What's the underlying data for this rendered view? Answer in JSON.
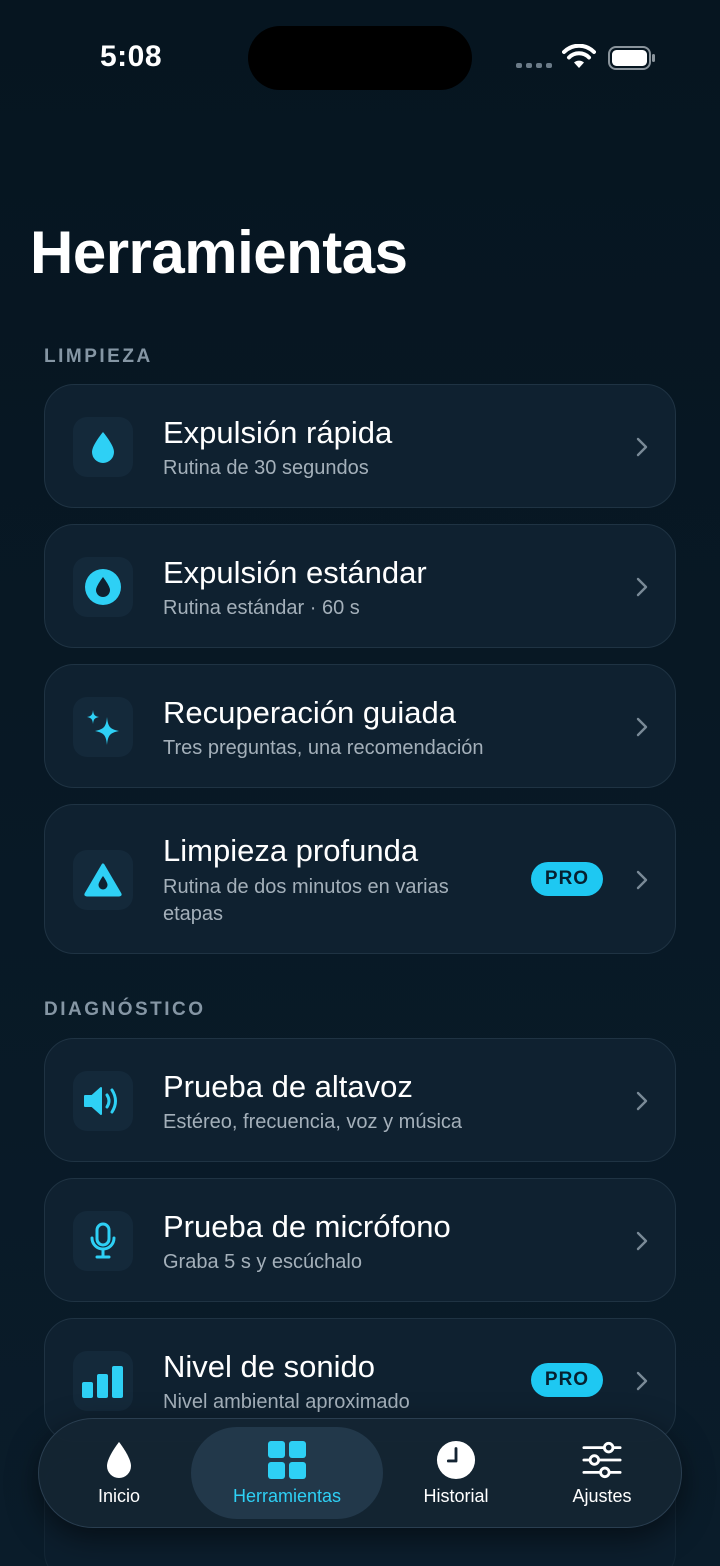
{
  "status_bar": {
    "time": "5:08"
  },
  "page": {
    "title": "Herramientas"
  },
  "sections": {
    "limpieza": "LIMPIEZA",
    "diagnostico": "DIAGNÓSTICO"
  },
  "cleaning_tools": [
    {
      "title": "Expulsión rápida",
      "subtitle": "Rutina de 30 segundos",
      "icon": "droplet-icon"
    },
    {
      "title": "Expulsión estándar",
      "subtitle": "Rutina estándar · 60 s",
      "icon": "droplet-circle-icon"
    },
    {
      "title": "Recuperación guiada",
      "subtitle": "Tres preguntas, una recomendación",
      "icon": "sparkles-icon"
    },
    {
      "title": "Limpieza profunda",
      "subtitle": "Rutina de dos minutos en varias etapas",
      "icon": "triangle-drop-icon",
      "badge": "PRO"
    }
  ],
  "diagnostic_tools": [
    {
      "title": "Prueba de altavoz",
      "subtitle": "Estéreo, frecuencia, voz y música",
      "icon": "speaker-icon"
    },
    {
      "title": "Prueba de micrófono",
      "subtitle": "Graba 5 s y escúchalo",
      "icon": "microphone-icon"
    },
    {
      "title": "Nivel de sonido",
      "subtitle": "Nivel ambiental aproximado",
      "icon": "bar-chart-icon",
      "badge": "PRO"
    }
  ],
  "tab_bar": {
    "tabs": [
      {
        "label": "Inicio",
        "icon": "droplet-icon"
      },
      {
        "label": "Herramientas",
        "icon": "grid-icon",
        "active": true
      },
      {
        "label": "Historial",
        "icon": "clock-icon"
      },
      {
        "label": "Ajustes",
        "icon": "sliders-icon"
      }
    ]
  },
  "colors": {
    "accent": "#1EC8F2",
    "background": "#071724",
    "card": "#0F2130"
  }
}
